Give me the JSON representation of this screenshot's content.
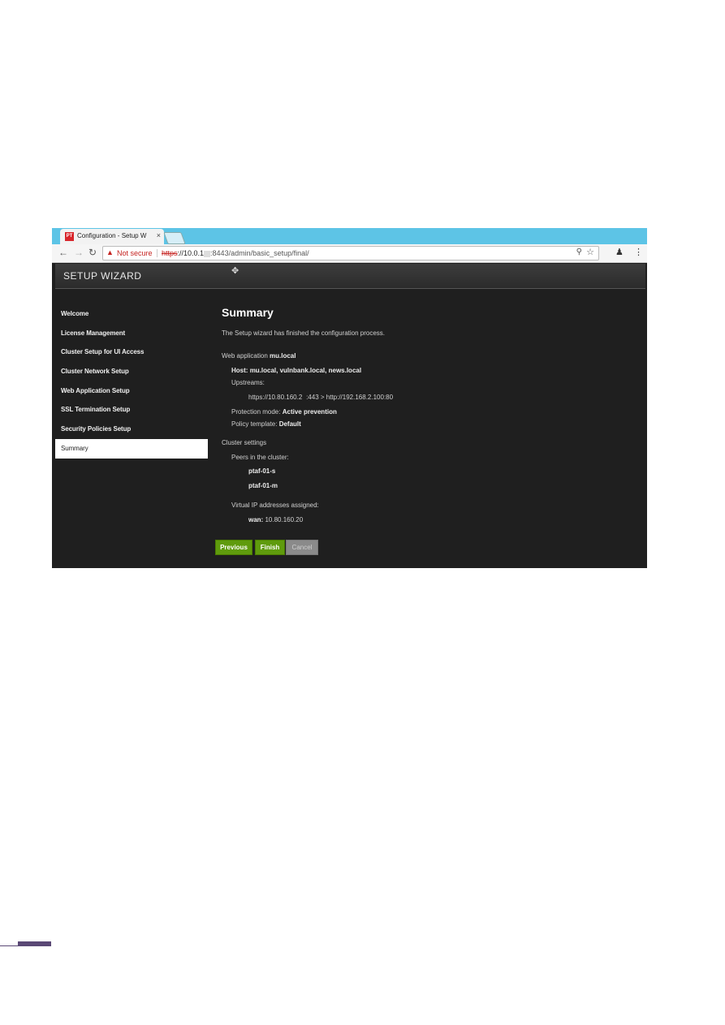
{
  "browser": {
    "tab_title": "Configuration - Setup W",
    "tab_favicon": "PT",
    "tab_close": "×",
    "not_secure": "Not secure",
    "url_scheme": "https",
    "url_host": "://10.0.1",
    "url_rest": ":8443/admin/basic_setup/final/",
    "icons": [
      "back-icon",
      "forward-icon",
      "reload-icon",
      "warning-icon",
      "zoom-icon",
      "star-icon",
      "extension-icon",
      "menu-icon"
    ]
  },
  "header": {
    "title": "SETUP WIZARD"
  },
  "sidebar": {
    "items": [
      {
        "label": "Welcome"
      },
      {
        "label": "License Management"
      },
      {
        "label": "Cluster Setup for UI Access"
      },
      {
        "label": "Cluster Network Setup"
      },
      {
        "label": "Web Application Setup"
      },
      {
        "label": "SSL Termination Setup"
      },
      {
        "label": "Security Policies Setup"
      },
      {
        "label": "Summary",
        "active": true
      }
    ]
  },
  "summary": {
    "title": "Summary",
    "intro": "The Setup wizard has finished the configuration process.",
    "webapp_label": "Web application",
    "webapp_name": "mu.local",
    "host_label": "Host:",
    "host_value": "mu.local, vulnbank.local, news.local",
    "upstreams_label": "Upstreams:",
    "upstream_value": "https://10.80.160.2   :443 > http://192.168.2.100:80",
    "protection_label": "Protection mode:",
    "protection_value": "Active prevention",
    "policy_label": "Policy template:",
    "policy_value": "Default",
    "cluster_label": "Cluster settings",
    "peers_label": "Peers in the cluster:",
    "peers": [
      "ptaf-01-s",
      "ptaf-01-m"
    ],
    "vip_label": "Virtual IP addresses assigned:",
    "vip_iface": "wan:",
    "vip_value": "10.80.160.20"
  },
  "buttons": {
    "previous": "Previous",
    "finish": "Finish",
    "cancel": "Cancel"
  },
  "colors": {
    "tabbar": "#5dc4e6",
    "accent_green": "#5f9b0d",
    "page_bg": "#1f1f1f",
    "footer": "#5a4875"
  }
}
